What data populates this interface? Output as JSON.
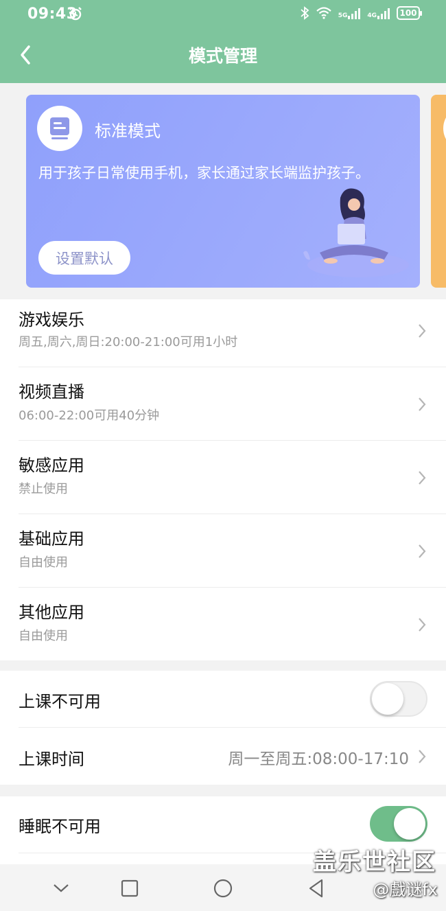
{
  "status_bar": {
    "time": "09:43",
    "battery": "100",
    "net1": "5G",
    "net2": "4G"
  },
  "header": {
    "title": "模式管理"
  },
  "mode_card": {
    "name": "标准模式",
    "description": "用于孩子日常使用手机，家长通过家长端监护孩子。",
    "default_button": "设置默认"
  },
  "categories": [
    {
      "title": "游戏娱乐",
      "subtitle": "周五,周六,周日:20:00-21:00可用1小时"
    },
    {
      "title": "视频直播",
      "subtitle": "06:00-22:00可用40分钟"
    },
    {
      "title": "敏感应用",
      "subtitle": "禁止使用"
    },
    {
      "title": "基础应用",
      "subtitle": "自由使用"
    },
    {
      "title": "其他应用",
      "subtitle": "自由使用"
    }
  ],
  "class_section": {
    "disable_label": "上课不可用",
    "disable_on": false,
    "time_label": "上课时间",
    "time_value": "周一至周五:08:00-17:10"
  },
  "sleep_section": {
    "disable_label": "睡眠不可用",
    "disable_on": true
  },
  "watermark": {
    "text": "盖乐世社区",
    "handle": "@戲谜fx"
  },
  "colors": {
    "header": "#7ec59d",
    "card": "#97a6fc",
    "toggle_on": "#6fbd8a",
    "next_card": "#f7bb67"
  }
}
